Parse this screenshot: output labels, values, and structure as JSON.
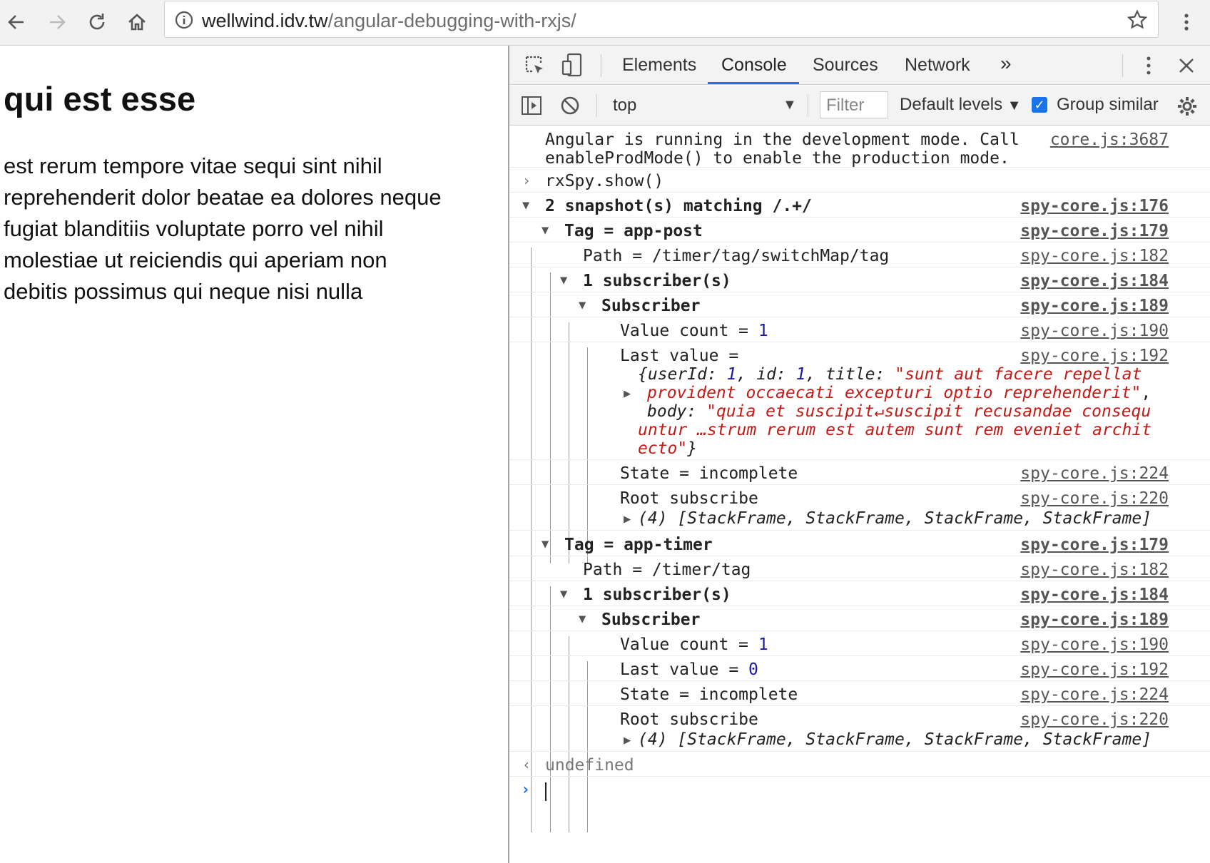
{
  "browser": {
    "url_domain": "wellwind.idv.tw",
    "url_path": "/angular-debugging-with-rxjs/"
  },
  "page": {
    "title": "qui est esse",
    "body_lines": [
      "est rerum tempore vitae sequi sint nihil",
      "reprehenderit dolor beatae ea dolores neque",
      "fugiat blanditiis voluptate porro vel nihil",
      "molestiae ut reiciendis qui aperiam non",
      "debitis possimus qui neque nisi nulla"
    ]
  },
  "devtools": {
    "tabs": [
      "Elements",
      "Console",
      "Sources",
      "Network"
    ],
    "active_tab": "Console",
    "more_tabs": "»",
    "context": "top",
    "filter_placeholder": "Filter",
    "levels": "Default levels",
    "group_similar": "Group similar",
    "group_similar_checked": true
  },
  "console": {
    "msg1_line1": "Angular is running in the development mode. Call",
    "msg1_line2": "enableProdMode() to enable the production mode.",
    "msg1_link": "core.js:3687",
    "cmd": "rxSpy.show()",
    "snap_header": "2 snapshot(s) matching /.+/",
    "link176": "spy-core.js:176",
    "link179": "spy-core.js:179",
    "link182": "spy-core.js:182",
    "link184": "spy-core.js:184",
    "link189": "spy-core.js:189",
    "link190": "spy-core.js:190",
    "link192": "spy-core.js:192",
    "link224": "spy-core.js:224",
    "link220": "spy-core.js:220",
    "tag1": "Tag = app-post",
    "path1": "Path = /timer/tag/switchMap/tag",
    "subs": "1 subscriber(s)",
    "subscriber": "Subscriber",
    "value_count_label": "Value count = ",
    "value_count": "1",
    "last_value_label": "Last value =",
    "lv_open": "{",
    "lv_userId_key": "userId",
    "lv_userId": "1",
    "lv_id_key": "id",
    "lv_id": "1",
    "lv_title_key": "title",
    "lv_title_1": "\"sunt aut facere repellat",
    "lv_title_2": "provident occaecati excepturi optio reprehenderit\"",
    "lv_body_key": "body",
    "lv_body_1": "\"quia et suscipit↵suscipit recusandae consequ",
    "lv_body_2": "untur …strum rerum est autem sunt rem eveniet archit",
    "lv_body_3": "ecto\"",
    "lv_close": "}",
    "state": "State = incomplete",
    "root": "Root subscribe",
    "stack": "(4) [StackFrame, StackFrame, StackFrame, StackFrame]",
    "tag2": "Tag = app-timer",
    "path2": "Path = /timer/tag",
    "last_value2_label": "Last value = ",
    "last_value2": "0",
    "result": "undefined"
  }
}
